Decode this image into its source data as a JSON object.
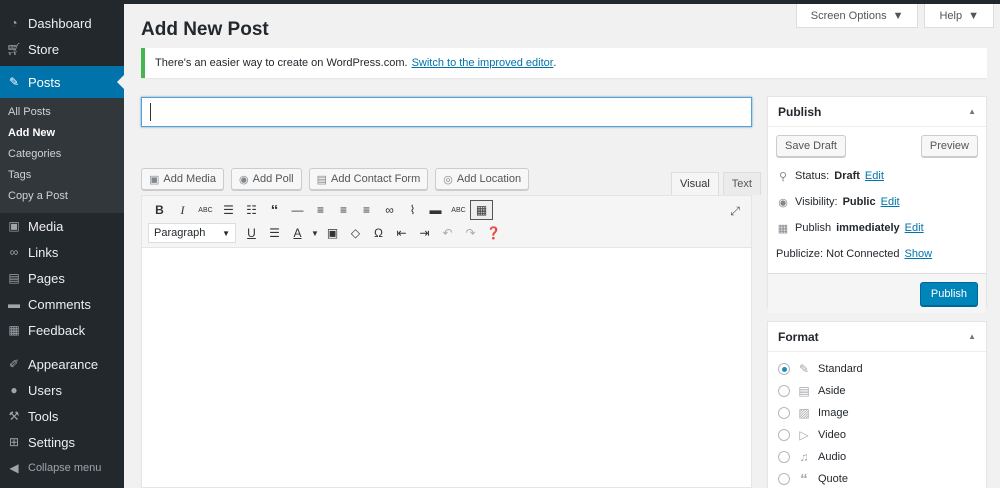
{
  "sidebar": {
    "items": [
      {
        "label": "Dashboard",
        "icon": "dashboard-icon"
      },
      {
        "label": "Store",
        "icon": "cart-icon"
      },
      {
        "label": "Posts",
        "icon": "pushpin-icon"
      },
      {
        "label": "Media",
        "icon": "media-icon"
      },
      {
        "label": "Links",
        "icon": "link-icon"
      },
      {
        "label": "Pages",
        "icon": "page-icon"
      },
      {
        "label": "Comments",
        "icon": "comment-icon"
      },
      {
        "label": "Feedback",
        "icon": "feedback-icon"
      },
      {
        "label": "Appearance",
        "icon": "brush-icon"
      },
      {
        "label": "Users",
        "icon": "user-icon"
      },
      {
        "label": "Tools",
        "icon": "wrench-icon"
      },
      {
        "label": "Settings",
        "icon": "settings-icon"
      },
      {
        "label": "Collapse menu",
        "icon": "collapse-icon"
      }
    ],
    "submenu": [
      "All Posts",
      "Add New",
      "Categories",
      "Tags",
      "Copy a Post"
    ]
  },
  "header": {
    "screen_options": "Screen Options",
    "help": "Help"
  },
  "page_title": "Add New Post",
  "notice": {
    "text": "There's an easier way to create on WordPress.com.",
    "link": "Switch to the improved editor",
    "suffix": "."
  },
  "title_field": {
    "value": ""
  },
  "media_buttons": [
    "Add Media",
    "Add Poll",
    "Add Contact Form",
    "Add Location"
  ],
  "editor_tabs": {
    "visual": "Visual",
    "text": "Text"
  },
  "toolbar": {
    "format_select": "Paragraph"
  },
  "publish": {
    "title": "Publish",
    "save_draft": "Save Draft",
    "preview": "Preview",
    "status_label": "Status:",
    "status_value": "Draft",
    "visibility_label": "Visibility:",
    "visibility_value": "Public",
    "publish_label": "Publish",
    "publish_value": "immediately",
    "edit": "Edit",
    "publicize_label": "Publicize: Not Connected",
    "publicize_link": "Show",
    "publish_button": "Publish"
  },
  "format": {
    "title": "Format",
    "options": [
      "Standard",
      "Aside",
      "Image",
      "Video",
      "Audio",
      "Quote"
    ],
    "selected": "Standard"
  },
  "colors": {
    "accent": "#0073aa",
    "sidebar": "#23282d",
    "primary_button": "#0085ba",
    "notice_border": "#46b450"
  }
}
